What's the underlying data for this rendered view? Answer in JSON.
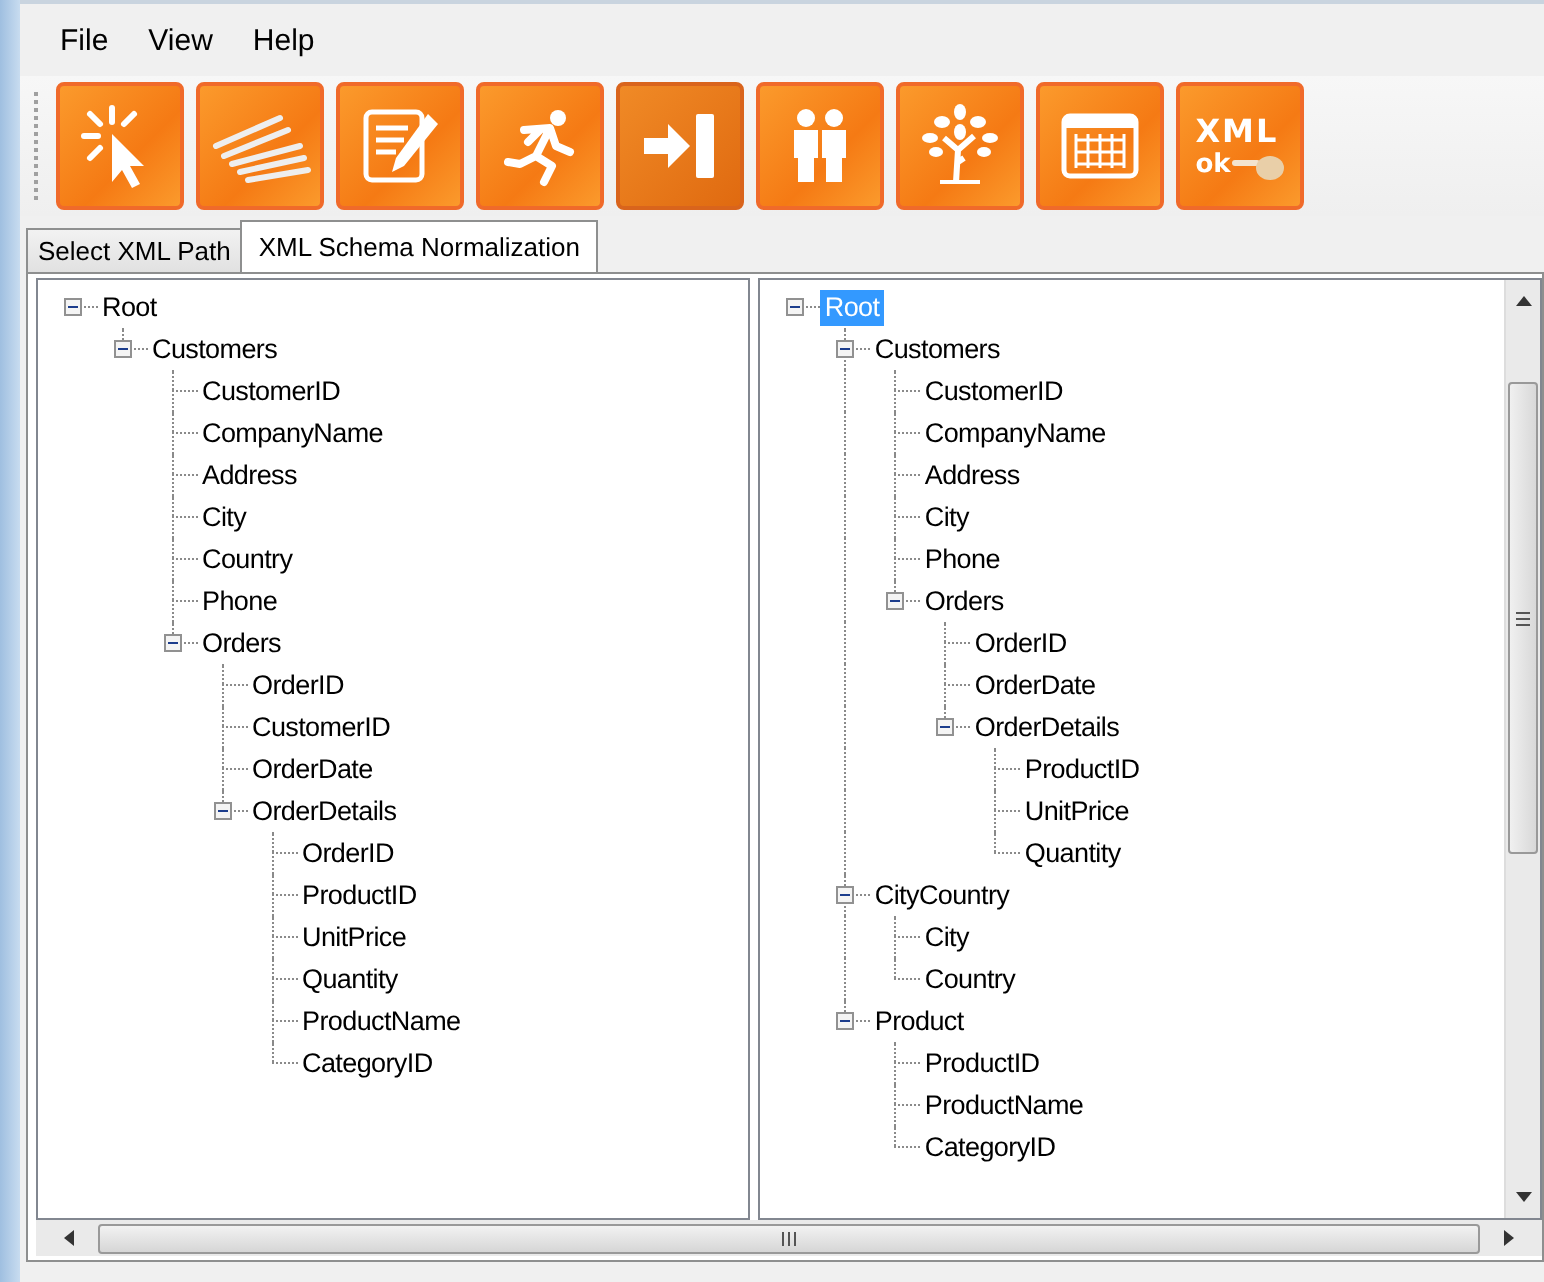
{
  "menu": [
    "File",
    "View",
    "Help"
  ],
  "toolbar": [
    {
      "kind": "cursor"
    },
    {
      "kind": "stairs"
    },
    {
      "kind": "edit"
    },
    {
      "kind": "runner"
    },
    {
      "kind": "enter"
    },
    {
      "kind": "people"
    },
    {
      "kind": "tree"
    },
    {
      "kind": "grid"
    },
    {
      "kind": "xml",
      "text_top": "XML",
      "text_bottom": "ok"
    }
  ],
  "tabs": [
    {
      "label": "Select XML Path",
      "selected": false
    },
    {
      "label": "XML Schema Normalization",
      "selected": true
    }
  ],
  "left_tree": [
    {
      "label": "Root",
      "selected": false,
      "expanded": true,
      "children": [
        {
          "label": "Customers",
          "selected": false,
          "expanded": true,
          "children": [
            {
              "label": "CustomerID",
              "selected": false
            },
            {
              "label": "CompanyName",
              "selected": false
            },
            {
              "label": "Address",
              "selected": false
            },
            {
              "label": "City",
              "selected": false
            },
            {
              "label": "Country",
              "selected": false
            },
            {
              "label": "Phone",
              "selected": false
            },
            {
              "label": "Orders",
              "selected": false,
              "expanded": true,
              "children": [
                {
                  "label": "OrderID",
                  "selected": false
                },
                {
                  "label": "CustomerID",
                  "selected": false
                },
                {
                  "label": "OrderDate",
                  "selected": false
                },
                {
                  "label": "OrderDetails",
                  "selected": false,
                  "expanded": true,
                  "children": [
                    {
                      "label": "OrderID",
                      "selected": false
                    },
                    {
                      "label": "ProductID",
                      "selected": false
                    },
                    {
                      "label": "UnitPrice",
                      "selected": false
                    },
                    {
                      "label": "Quantity",
                      "selected": false
                    },
                    {
                      "label": "ProductName",
                      "selected": false
                    },
                    {
                      "label": "CategoryID",
                      "selected": false
                    }
                  ]
                }
              ]
            }
          ]
        }
      ]
    }
  ],
  "right_tree": [
    {
      "label": "Root",
      "selected": true,
      "expanded": true,
      "children": [
        {
          "label": "Customers",
          "selected": false,
          "expanded": true,
          "children": [
            {
              "label": "CustomerID",
              "selected": false
            },
            {
              "label": "CompanyName",
              "selected": false
            },
            {
              "label": "Address",
              "selected": false
            },
            {
              "label": "City",
              "selected": false
            },
            {
              "label": "Phone",
              "selected": false
            },
            {
              "label": "Orders",
              "selected": false,
              "expanded": true,
              "children": [
                {
                  "label": "OrderID",
                  "selected": false
                },
                {
                  "label": "OrderDate",
                  "selected": false
                },
                {
                  "label": "OrderDetails",
                  "selected": false,
                  "expanded": true,
                  "children": [
                    {
                      "label": "ProductID",
                      "selected": false
                    },
                    {
                      "label": "UnitPrice",
                      "selected": false
                    },
                    {
                      "label": "Quantity",
                      "selected": false
                    }
                  ]
                }
              ]
            }
          ]
        },
        {
          "label": "CityCountry",
          "selected": false,
          "expanded": true,
          "children": [
            {
              "label": "City",
              "selected": false
            },
            {
              "label": "Country",
              "selected": false
            }
          ]
        },
        {
          "label": "Product",
          "selected": false,
          "expanded": true,
          "children": [
            {
              "label": "ProductID",
              "selected": false
            },
            {
              "label": "ProductName",
              "selected": false
            },
            {
              "label": "CategoryID",
              "selected": false
            }
          ]
        }
      ]
    }
  ]
}
